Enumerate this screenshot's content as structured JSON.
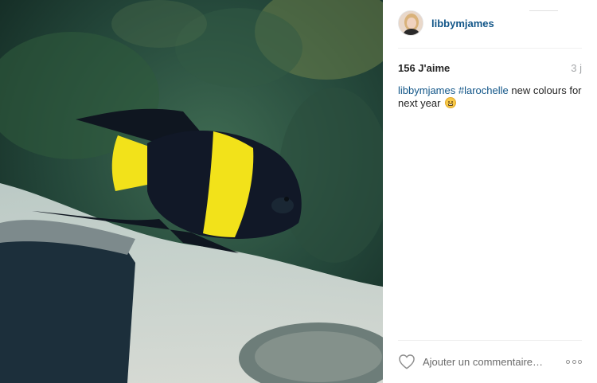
{
  "photo": {
    "description_icon": "fish-photo",
    "colors": {
      "water": "#1f4a3e",
      "fish_body": "#111827",
      "fish_stripe": "#f2e21a",
      "sand": "#d7dcd6"
    }
  },
  "post": {
    "username": "libbymjames",
    "likes": "156 J'aime",
    "time_ago": "3 j",
    "caption": {
      "user": "libbymjames",
      "hashtag": "#larochelle",
      "text": " new colours for next year",
      "emoji": "grimacing-face-icon"
    },
    "comment_placeholder": "Ajouter un commentaire…"
  },
  "colors": {
    "link": "#125688",
    "muted": "#a5a7aa",
    "divider": "#efefef"
  }
}
